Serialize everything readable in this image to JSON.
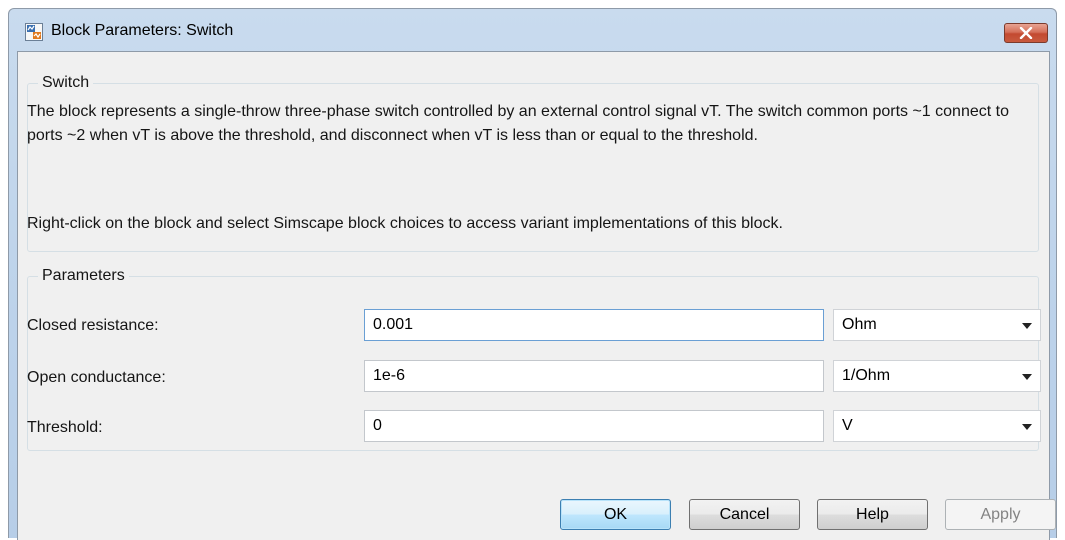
{
  "window": {
    "title": "Block Parameters: Switch"
  },
  "description_group": {
    "label": "Switch",
    "text": "The block represents a single-throw three-phase switch controlled by an external control signal vT. The switch common ports ~1 connect to ports ~2 when vT is above the threshold, and disconnect when vT is less than or equal to the threshold.",
    "note": "Right-click on the block and select Simscape block choices to access variant implementations of this block."
  },
  "parameters_group": {
    "label": "Parameters",
    "rows": [
      {
        "label": "Closed resistance:",
        "value": "0.001",
        "unit": "Ohm"
      },
      {
        "label": "Open conductance:",
        "value": "1e-6",
        "unit": "1/Ohm"
      },
      {
        "label": "Threshold:",
        "value": "0",
        "unit": "V"
      }
    ]
  },
  "buttons": {
    "ok": "OK",
    "cancel": "Cancel",
    "help": "Help",
    "apply": "Apply"
  },
  "icons": {
    "app": "simulink-block-icon",
    "close": "close-icon",
    "dropdown": "chevron-down-icon"
  },
  "colors": {
    "titlebar": "#bcd2ea",
    "close_button": "#c85a3f",
    "client_background": "#f0f0f0",
    "default_button": "#bee6fd"
  }
}
